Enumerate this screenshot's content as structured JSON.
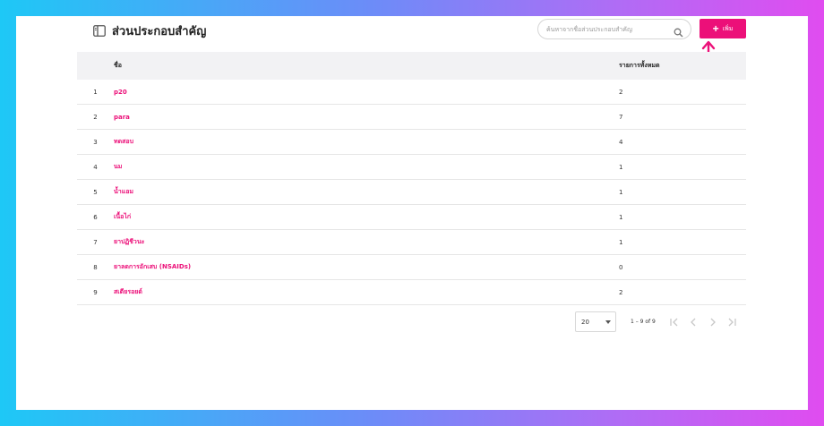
{
  "header": {
    "title": "ส่วนประกอบสำคัญ",
    "title_icon": "sidebar-panel-icon",
    "search_placeholder": "ค้นหาจากชื่อส่วนประกอบสำคัญ",
    "search_icon": "search-icon",
    "add_label": "เพิ่ม",
    "accent": "#ec1079"
  },
  "table": {
    "columns": [
      "ชื่อ",
      "รายการทั้งหมด"
    ],
    "rows": [
      {
        "index": "1",
        "name": "p20",
        "count": "2"
      },
      {
        "index": "2",
        "name": "para",
        "count": "7"
      },
      {
        "index": "3",
        "name": "ทดสอบ",
        "count": "4"
      },
      {
        "index": "4",
        "name": "นม",
        "count": "1"
      },
      {
        "index": "5",
        "name": "น้ำแอม",
        "count": "1"
      },
      {
        "index": "6",
        "name": "เนื้อไก่",
        "count": "1"
      },
      {
        "index": "7",
        "name": "ยาปฏิชีวนะ",
        "count": "1"
      },
      {
        "index": "8",
        "name": "ยาลดการอักเสบ (NSAIDs)",
        "count": "0"
      },
      {
        "index": "9",
        "name": "สเตียรอยด์",
        "count": "2"
      }
    ]
  },
  "pagination": {
    "page_size": "20",
    "range_text": "1 – 9 of 9"
  }
}
